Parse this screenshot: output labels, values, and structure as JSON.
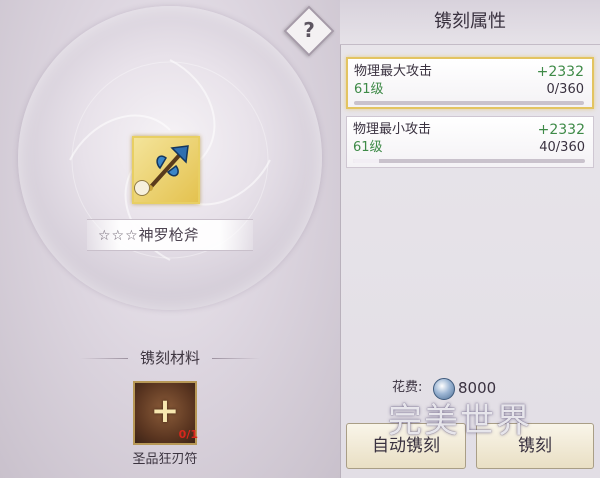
{
  "help": {
    "symbol": "?"
  },
  "item": {
    "stars": "☆☆☆",
    "name": "神罗枪斧",
    "icon": "axe-spear-icon"
  },
  "materials": {
    "title": "镌刻材料",
    "item_name": "圣品狂刃符",
    "count": "0/1",
    "icon": "plus-icon"
  },
  "panel": {
    "title": "镌刻属性",
    "attributes": [
      {
        "name": "物理最大攻击",
        "level": "61级",
        "bonus": "+2332",
        "progress": "0/360",
        "fraction": 0.0,
        "selected": true
      },
      {
        "name": "物理最小攻击",
        "level": "61级",
        "bonus": "+2332",
        "progress": "40/360",
        "fraction": 0.111,
        "selected": false
      }
    ]
  },
  "cost": {
    "label": "花费:",
    "value": "8000",
    "icon": "silver-coin-icon"
  },
  "buttons": {
    "auto": "自动镌刻",
    "engrave": "镌刻"
  },
  "watermark": {
    "logo": "完美世界"
  },
  "colors": {
    "selected_border": "#e3c461",
    "bonus_green": "#3e8a47",
    "count_red": "#d8261c"
  }
}
